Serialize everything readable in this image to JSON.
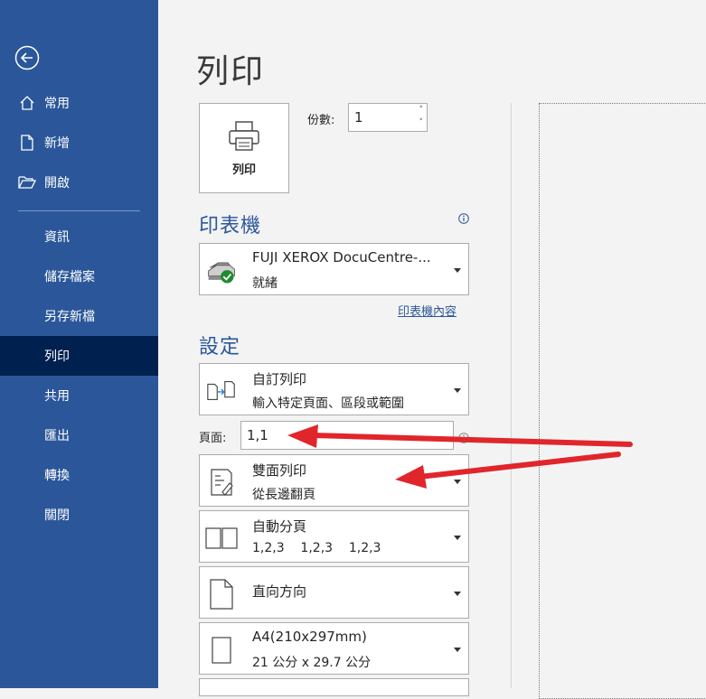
{
  "sidebar": {
    "items": [
      {
        "label": "常用",
        "icon": "home-icon"
      },
      {
        "label": "新增",
        "icon": "new-document-icon"
      },
      {
        "label": "開啟",
        "icon": "folder-open-icon"
      },
      {
        "label": "資訊"
      },
      {
        "label": "儲存檔案"
      },
      {
        "label": "另存新檔"
      },
      {
        "label": "列印",
        "active": true
      },
      {
        "label": "共用"
      },
      {
        "label": "匯出"
      },
      {
        "label": "轉換"
      },
      {
        "label": "關閉"
      }
    ]
  },
  "main": {
    "title": "列印",
    "print_button_label": "列印",
    "copies_label": "份數:",
    "copies_value": "1",
    "printer_section": "印表機",
    "printer": {
      "name": "FUJI XEROX DocuCentre-...",
      "status": "就緒"
    },
    "printer_properties_link": "印表機內容",
    "settings_section": "設定",
    "print_range": {
      "line1": "自訂列印",
      "line2": "輸入特定頁面、區段或範圍"
    },
    "pages_label": "頁面:",
    "pages_value": "1,1",
    "duplex": {
      "line1": "雙面列印",
      "line2": "從長邊翻頁"
    },
    "collate": {
      "line1": "自動分頁",
      "line2": "1,2,3    1,2,3    1,2,3"
    },
    "orientation": {
      "line1": "直向方向"
    },
    "paper_size": {
      "line1": "A4(210x297mm)",
      "line2": "21 公分 x 29.7 公分"
    }
  },
  "colors": {
    "sidebar": "#2b579a",
    "sidebar_active": "#002050",
    "accent": "#2b579a",
    "annotation_arrow": "#e0262b"
  }
}
